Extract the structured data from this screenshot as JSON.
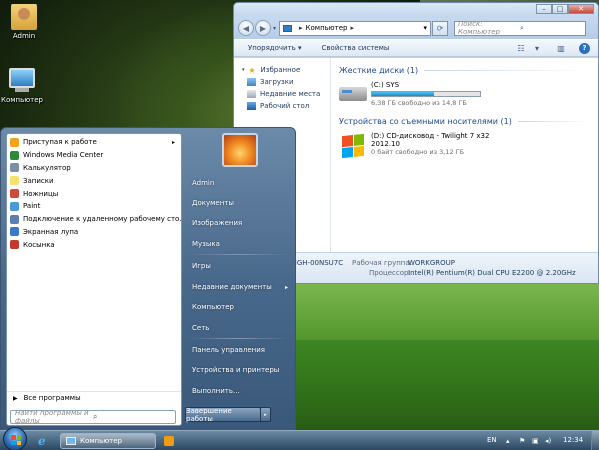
{
  "desktop": {
    "icons": [
      {
        "label": "Admin",
        "icon": "user-folder-icon"
      },
      {
        "label": "Компьютер",
        "icon": "computer-icon"
      }
    ]
  },
  "explorer": {
    "address": {
      "segment": "Компьютер"
    },
    "search_placeholder": "Поиск: Компьютер",
    "toolbar": {
      "organize": "Упорядочить",
      "system_properties": "Свойства системы"
    },
    "nav": {
      "favorites": "Избранное",
      "items": [
        "Загрузки",
        "Недавние места",
        "Рабочий стол"
      ]
    },
    "groups": {
      "hard_disks": "Жесткие диски (1)",
      "removable": "Устройства со съемными носителями (1)"
    },
    "drives": [
      {
        "name": "(C:) SYS",
        "free": "6,38 ГБ свободно из 14,8 ГБ",
        "used_fraction": 0.57,
        "icon": "hard-disk-icon"
      },
      {
        "name": "(D:) CD-дисковод - Twilight 7 x32",
        "line2": "2012.10",
        "free": "0 байт свободно из 3,12 ГБ",
        "icon": "cd-drive-icon"
      }
    ],
    "details": {
      "computer_name_partial": "BIGH-00NSU7C",
      "workgroup_label": "Рабочая группа:",
      "workgroup_value": "WORKGROUP",
      "cpu_label": "Процессор:",
      "cpu_value": "Intel(R) Pentium(R) Dual  CPU  E2200  @ 2.20GHz"
    }
  },
  "start_menu": {
    "programs": [
      {
        "label": "Приступая к работе",
        "arrow": "▸",
        "color": "#f2a51a"
      },
      {
        "label": "Windows Media Center",
        "color": "#2e8b3a"
      },
      {
        "label": "Калькулятор",
        "color": "#7a8ea6"
      },
      {
        "label": "Записки",
        "color": "#f4e36a"
      },
      {
        "label": "Ножницы",
        "color": "#d04a3a"
      },
      {
        "label": "Paint",
        "color": "#4a9ad4"
      },
      {
        "label": "Подключение к удаленному рабочему сто...",
        "color": "#5a7fb0"
      },
      {
        "label": "Экранная лупа",
        "color": "#3a78c8"
      },
      {
        "label": "Косынка",
        "color": "#c23b2e"
      }
    ],
    "all_programs": "Все программы",
    "search_placeholder": "Найти программы и файлы",
    "right_items": {
      "user": "Admin",
      "documents": "Документы",
      "pictures": "Изображения",
      "music": "Музыка",
      "games": "Игры",
      "recent": "Недавние документы",
      "computer": "Компьютер",
      "network": "Сеть",
      "control_panel": "Панель управления",
      "devices": "Устройства и принтеры",
      "run": "Выполнить..."
    },
    "shutdown": "Завершение работы",
    "arrow": "▸"
  },
  "taskbar": {
    "window_button": "Компьютер",
    "language": "EN",
    "clock": "12:34"
  }
}
